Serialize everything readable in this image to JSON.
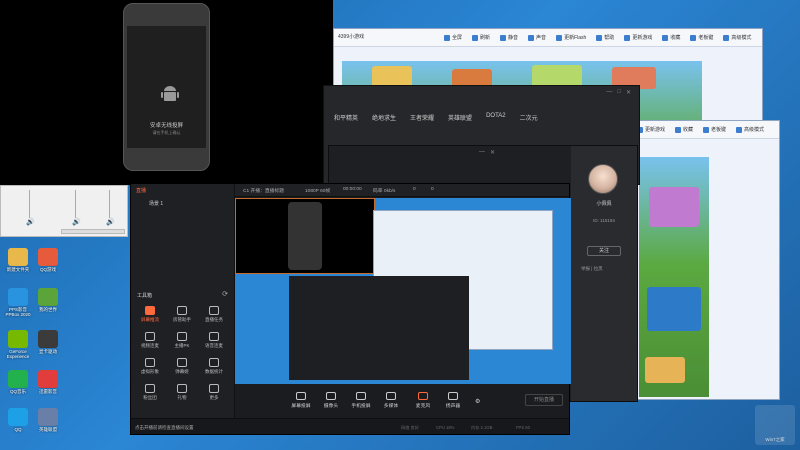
{
  "phone": {
    "title": "安卓无线投屏",
    "subtitle": "请在手机上确认"
  },
  "desktop_icons": [
    {
      "label": "新建文件夹",
      "color": "#e8b84a"
    },
    {
      "label": "QQ游戏",
      "color": "#e55b3c"
    },
    {
      "label": "PPS影音 PPBox 2020",
      "color": "#2a93e0"
    },
    {
      "label": "我的世界",
      "color": "#5aa43a"
    },
    {
      "label": "GeForce Experience",
      "color": "#76b900"
    },
    {
      "label": "显卡驱动",
      "color": "#3b3b3b"
    },
    {
      "label": "QQ音乐",
      "color": "#23b14d"
    },
    {
      "label": "迅雷影音",
      "color": "#e23d3d"
    },
    {
      "label": "QQ",
      "color": "#1ea0e6"
    },
    {
      "label": "英雄联盟",
      "color": "#6a7fa8"
    }
  ],
  "browser_back": {
    "tab": "4399小游戏",
    "toolbar": [
      "全屏",
      "刷新",
      "静音",
      "声音",
      "更新Flash",
      "帮助",
      "更新游戏",
      "收藏",
      "老板键",
      "高级模式"
    ]
  },
  "browser_front": {
    "toolbar": [
      "更新游戏",
      "收藏",
      "老板键",
      "高级模式"
    ]
  },
  "room": {
    "tabs": [
      "和平精英",
      "绝地求生",
      "王者荣耀",
      "英雄联盟",
      "DOTA2",
      "二次元"
    ]
  },
  "viewer": {
    "user_name": "小佩佩",
    "user_id": "ID: 115194",
    "follow_label": "关注",
    "report_label": "举报 | 拉黑"
  },
  "obs": {
    "live_label": "直播",
    "scene": "场景 1",
    "top_items": [
      "C1 开播：直播标题",
      "1080P 60帧",
      "00:00:00",
      "码率 0kb/s",
      "0",
      "0"
    ],
    "tool_title": "工具箱",
    "tools": [
      {
        "label": "屏幕推流",
        "active": true
      },
      {
        "label": "房管助手",
        "active": false
      },
      {
        "label": "直播任务",
        "active": false
      },
      {
        "label": "视频连麦",
        "active": false
      },
      {
        "label": "主播PK",
        "active": false
      },
      {
        "label": "语音连麦",
        "active": false
      },
      {
        "label": "虚拟形象",
        "active": false
      },
      {
        "label": "弹幕姬",
        "active": false
      },
      {
        "label": "数据统计",
        "active": false
      },
      {
        "label": "粉丝团",
        "active": false
      },
      {
        "label": "礼物",
        "active": false
      },
      {
        "label": "更多",
        "active": false
      }
    ],
    "bottom_tools": [
      "屏幕投屏",
      "摄像头",
      "手机投屏",
      "多媒体",
      "麦克风",
      "扬声器"
    ],
    "start_label": "开始直播",
    "notice": "点击开播前请检查直播间设置",
    "stats": [
      "网络 良好",
      "CPU 18%",
      "内存 2.1GB",
      "FPS 60"
    ]
  },
  "watermark": "Win7之家",
  "colors": {
    "accent": "#ff6a3d",
    "desktop_blue": "#2b86d4",
    "dark_panel": "#1b1c20"
  }
}
